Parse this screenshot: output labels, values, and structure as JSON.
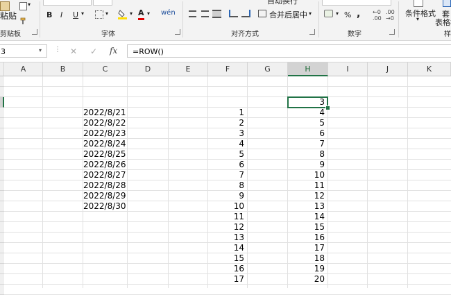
{
  "ribbon": {
    "paste_label": "粘贴",
    "clipboard_group": "剪贴板",
    "bold": "B",
    "italic": "I",
    "underline": "U",
    "font_color_glyph": "A",
    "font_group": "字体",
    "wrap_label": "自动换行",
    "merge_label": "合并后居中",
    "alignment_group": "对齐方式",
    "percent": "%",
    "comma": ",",
    "number_group": "数字",
    "cond_format_label": "条件格式",
    "table_format_line1": "套",
    "table_format_line2": "表格格",
    "styles_group": "样"
  },
  "formula_bar": {
    "name_box": "3",
    "cancel": "✕",
    "enter": "✓",
    "fx": "fx",
    "formula": "=ROW()"
  },
  "grid": {
    "columns": [
      "A",
      "B",
      "C",
      "D",
      "E",
      "F",
      "G",
      "H",
      "I",
      "J",
      "K"
    ],
    "selected_column": "H",
    "selected_cell": "H3",
    "c_values": [
      "2022/8/21",
      "2022/8/22",
      "2022/8/23",
      "2022/8/24",
      "2022/8/25",
      "2022/8/26",
      "2022/8/27",
      "2022/8/28",
      "2022/8/29",
      "2022/8/30"
    ],
    "f_values": [
      "1",
      "2",
      "3",
      "4",
      "5",
      "6",
      "7",
      "8",
      "9",
      "10",
      "11",
      "12",
      "13",
      "14",
      "15",
      "16",
      "17"
    ],
    "h_values": [
      "3",
      "4",
      "5",
      "6",
      "7",
      "8",
      "9",
      "10",
      "11",
      "12",
      "13",
      "14",
      "15",
      "16",
      "17",
      "18",
      "19",
      "20"
    ]
  }
}
